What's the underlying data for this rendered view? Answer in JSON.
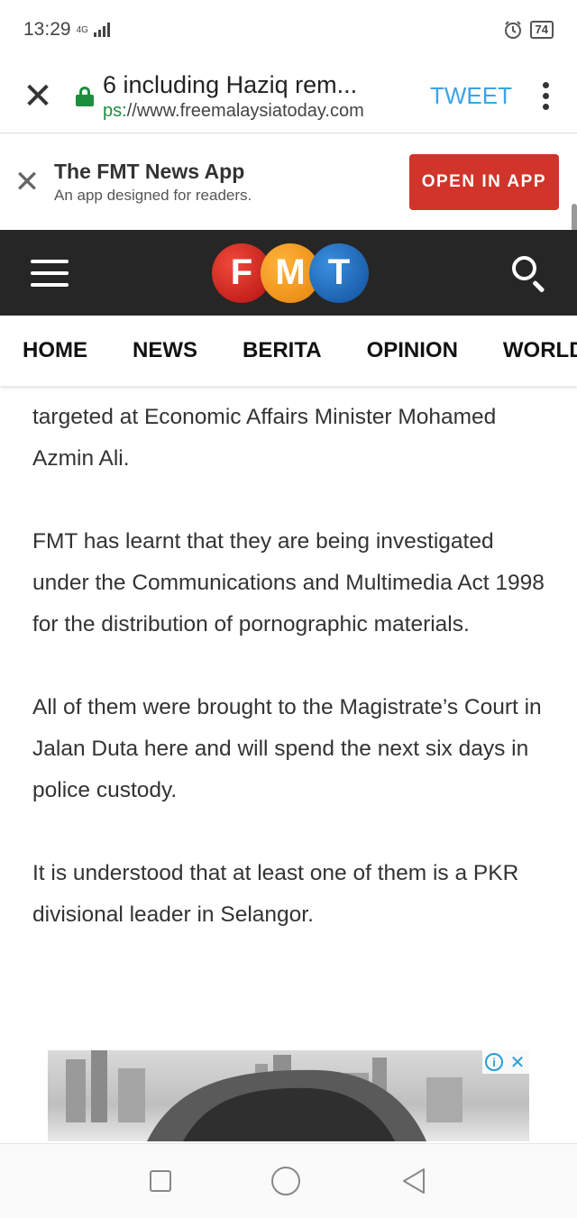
{
  "status": {
    "time": "13:29",
    "network": "4G",
    "battery": "74"
  },
  "tabbar": {
    "page_title": "6 including Haziq rem...",
    "url_scheme": "ps:",
    "url_rest": "//www.freemalaysiatoday.com",
    "tweet_label": "TWEET"
  },
  "app_banner": {
    "title": "The FMT News App",
    "subtitle": "An app designed for readers.",
    "open_button": "OPEN IN APP"
  },
  "site": {
    "logo": [
      "F",
      "M",
      "T"
    ],
    "nav": [
      "HOME",
      "NEWS",
      "BERITA",
      "OPINION",
      "WORLD"
    ]
  },
  "article": {
    "paragraphs": [
      "targeted at Economic Affairs Minister Mohamed Azmin Ali.",
      "FMT has learnt that they are being investigated under the Communications and Multimedia Act 1998 for the distribution of pornographic materials.",
      "All of them were brought to the Magistrate’s Court in Jalan Duta here and will spend the next six days in police custody.",
      "It is understood that at least one of them is a PKR divisional leader in Selangor."
    ]
  },
  "ad": {
    "info_icon": "i",
    "close_icon": "✕"
  },
  "colors": {
    "lock_green": "#1e8e3e",
    "tweet_blue": "#3ba3e8",
    "open_button_red": "#d1342a",
    "header_dark": "#262626"
  }
}
